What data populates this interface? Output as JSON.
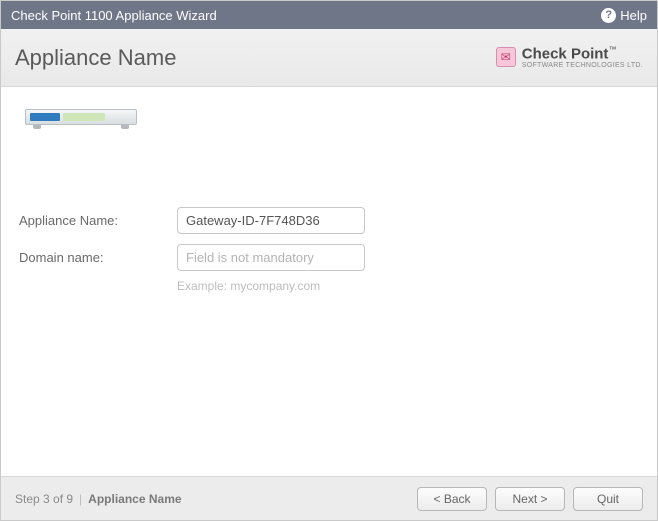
{
  "window": {
    "title": "Check Point 1100 Appliance Wizard",
    "help_label": "Help"
  },
  "header": {
    "title": "Appliance Name",
    "brand_main": "Check Point",
    "brand_sub": "SOFTWARE TECHNOLOGIES LTD."
  },
  "form": {
    "appliance_label": "Appliance Name:",
    "appliance_value": "Gateway-ID-7F748D36",
    "domain_label": "Domain name:",
    "domain_value": "",
    "domain_placeholder": "Field is not mandatory",
    "domain_hint": "Example: mycompany.com"
  },
  "footer": {
    "step_text": "Step 3 of 9",
    "step_name": "Appliance Name",
    "back_label": "< Back",
    "next_label": "Next >",
    "quit_label": "Quit"
  }
}
